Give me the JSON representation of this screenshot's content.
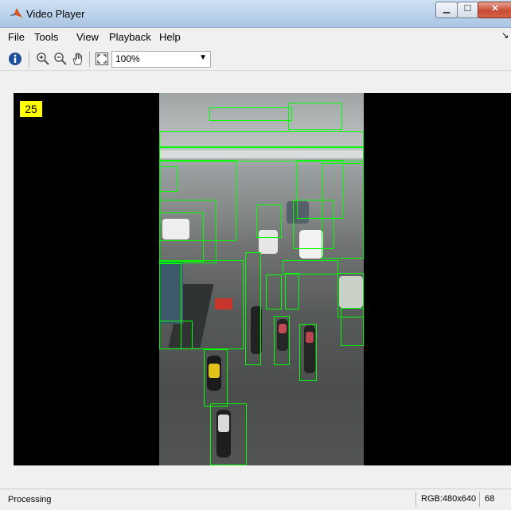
{
  "window": {
    "title": "Video Player"
  },
  "menu": {
    "items": [
      "File",
      "Tools",
      "View",
      "Playback",
      "Help"
    ]
  },
  "toolbar": {
    "zoom_value": "100%"
  },
  "viewer": {
    "frame_number": "25"
  },
  "status": {
    "text": "Processing",
    "format": "RGB:480x640",
    "frame": "68"
  },
  "icons": {
    "app": "matlab-logo-icon",
    "info": "info-icon",
    "zoom_in": "zoom-in-icon",
    "zoom_out": "zoom-out-icon",
    "pan": "hand-pan-icon",
    "fit": "fit-to-window-icon"
  },
  "colors": {
    "detection_box": "#00ff00",
    "frame_label_bg": "#ffff00",
    "viewer_bg": "#000000"
  }
}
